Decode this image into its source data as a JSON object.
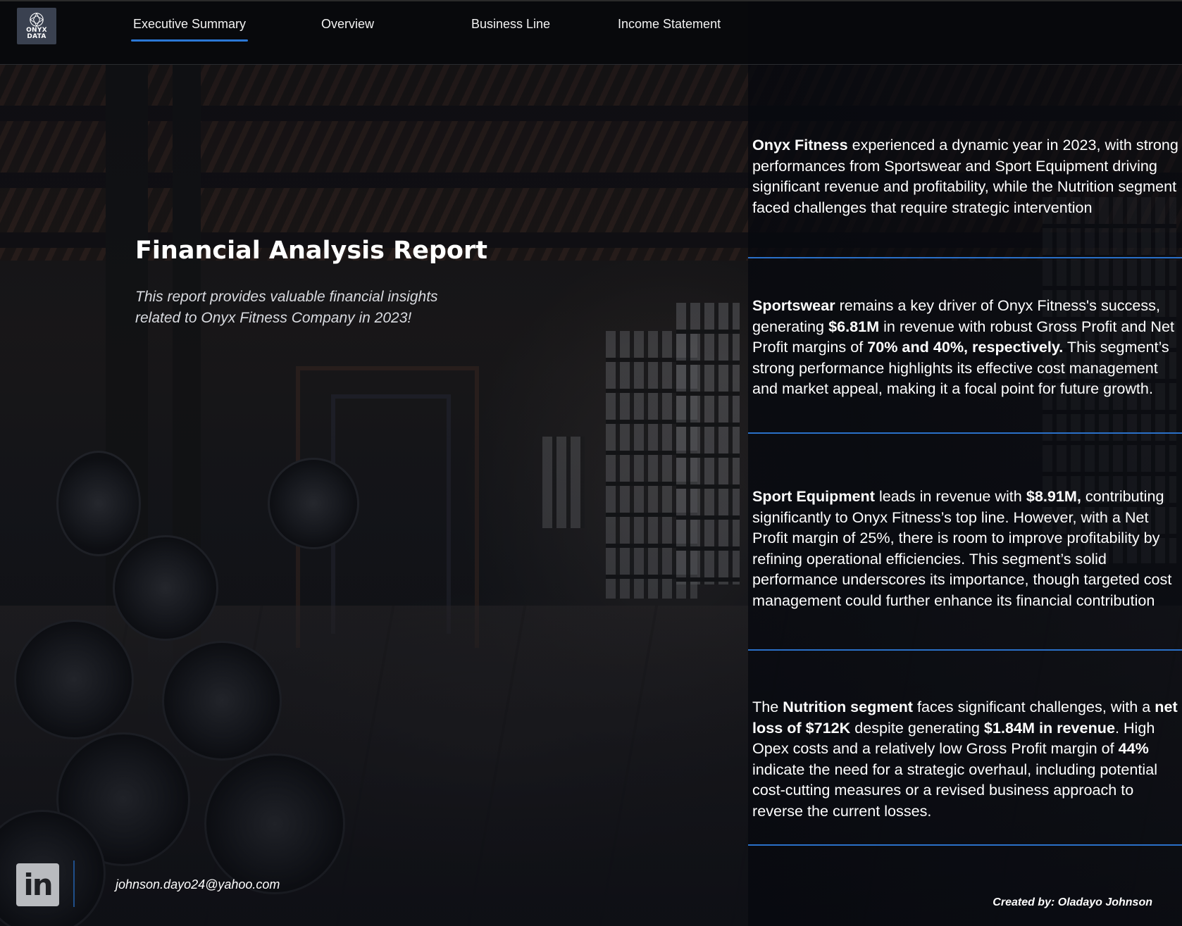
{
  "brand": {
    "logo_text": "ONYX\nDATA",
    "logo_icon": "globe-icon"
  },
  "nav": {
    "tabs": [
      {
        "label": "Executive Summary",
        "active": true
      },
      {
        "label": "Overview",
        "active": false
      },
      {
        "label": "Business Line",
        "active": false
      },
      {
        "label": "Income Statement",
        "active": false
      }
    ]
  },
  "hero": {
    "title": "Financial Analysis Report",
    "subtitle": "This report provides valuable financial insights related to Onyx Fitness Company in 2023!"
  },
  "insights": [
    {
      "segments": [
        {
          "text": "Onyx Fitness",
          "bold": true
        },
        {
          "text": " experienced a dynamic year in 2023, with strong performances from Sportswear and Sport Equipment driving significant revenue and profitability, while the Nutrition segment faced challenges that require strategic intervention",
          "bold": false
        }
      ]
    },
    {
      "segments": [
        {
          "text": "Sportswear",
          "bold": true
        },
        {
          "text": " remains a key driver of Onyx Fitness's success, generating ",
          "bold": false
        },
        {
          "text": "$6.81M",
          "bold": true
        },
        {
          "text": " in revenue with robust Gross Profit and Net Profit margins of ",
          "bold": false
        },
        {
          "text": "70% and 40%, respectively.",
          "bold": true
        },
        {
          "text": " This segment’s strong performance highlights its effective cost management and market appeal, making it a focal point for future growth.",
          "bold": false
        }
      ]
    },
    {
      "segments": [
        {
          "text": "Sport Equipment",
          "bold": true
        },
        {
          "text": " leads in revenue with ",
          "bold": false
        },
        {
          "text": "$8.91M,",
          "bold": true
        },
        {
          "text": " contributing significantly to Onyx Fitness’s top line. However, with a Net Profit margin of 25%, there is room to improve profitability by refining operational efficiencies. This segment’s solid performance underscores its importance, though targeted cost management could further enhance its financial contribution",
          "bold": false
        }
      ]
    },
    {
      "segments": [
        {
          "text": "The ",
          "bold": false
        },
        {
          "text": "Nutrition segment",
          "bold": true
        },
        {
          "text": " faces significant challenges, with a ",
          "bold": false
        },
        {
          "text": "net loss of $712K",
          "bold": true
        },
        {
          "text": " despite generating ",
          "bold": false
        },
        {
          "text": "$1.84M in revenue",
          "bold": true
        },
        {
          "text": ". High Opex costs and a relatively low Gross Profit margin of ",
          "bold": false
        },
        {
          "text": "44%",
          "bold": true
        },
        {
          "text": " indicate the need for a strategic overhaul, including potential cost-cutting measures or a revised business approach to reverse the current losses.",
          "bold": false
        }
      ]
    }
  ],
  "footer": {
    "linkedin_label": "in",
    "linkedin_icon": "linkedin-icon",
    "email": "johnson.dayo24@yahoo.com",
    "credit": "Created by: Oladayo Johnson"
  },
  "colors": {
    "accent": "#2b78d6",
    "divider": "#2a70c8",
    "logo_bg": "#3a4150"
  }
}
